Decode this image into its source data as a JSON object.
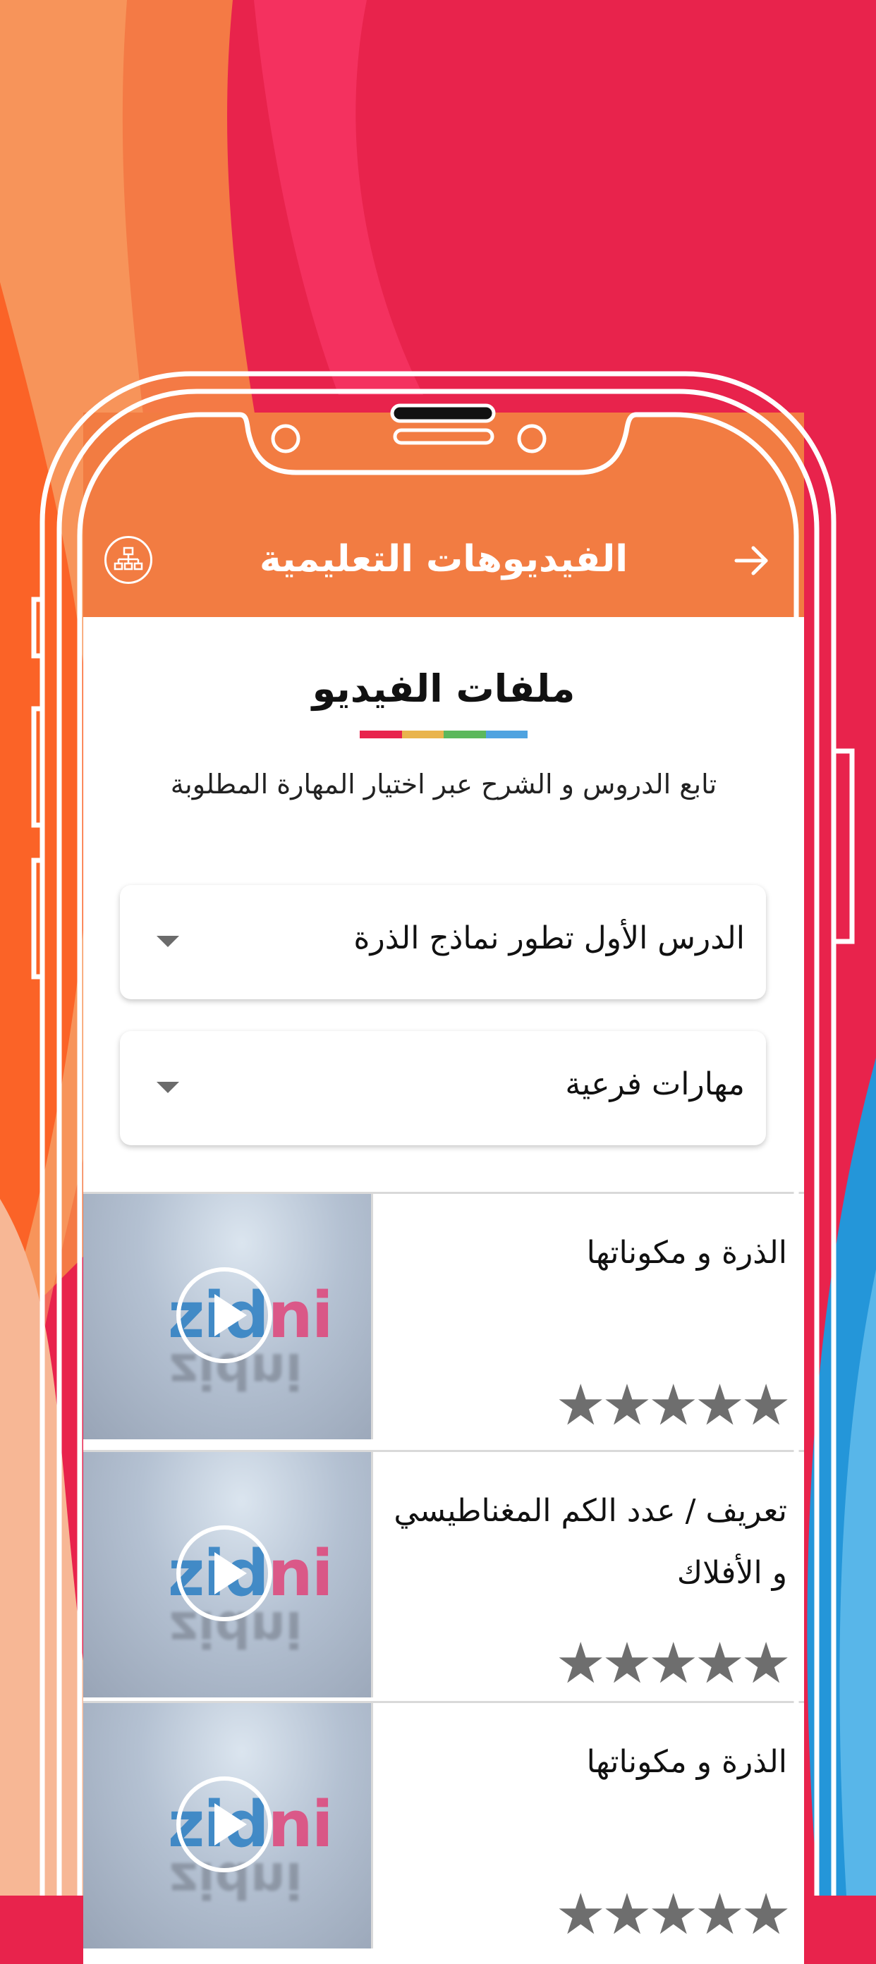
{
  "appbar": {
    "title": "الفيديوهات التعليمية",
    "back_icon": "arrow-right-icon",
    "menu_icon": "sitemap-icon",
    "color": "#f27c42"
  },
  "section": {
    "title": "ملفات الفيديو",
    "accent_colors": [
      "#e8234c",
      "#e9b44c",
      "#5cb85c",
      "#4fa3e0"
    ],
    "subtitle": "تابع الدروس و الشرح عبر اختيار المهارة المطلوبة"
  },
  "dropdowns": [
    {
      "value": "الدرس الأول تطور نماذج الذرة"
    },
    {
      "value": "مهارات فرعية"
    }
  ],
  "videos": [
    {
      "title": "الذرة و مكوناتها",
      "rating": 5
    },
    {
      "title": "تعريف / عدد الكم المغناطيسي و الأفلاك",
      "rating": 5
    },
    {
      "title": "الذرة و مكوناتها",
      "rating": 5
    }
  ],
  "thumbnail_brand": "zidni",
  "stars_glyph": "★★★★★"
}
